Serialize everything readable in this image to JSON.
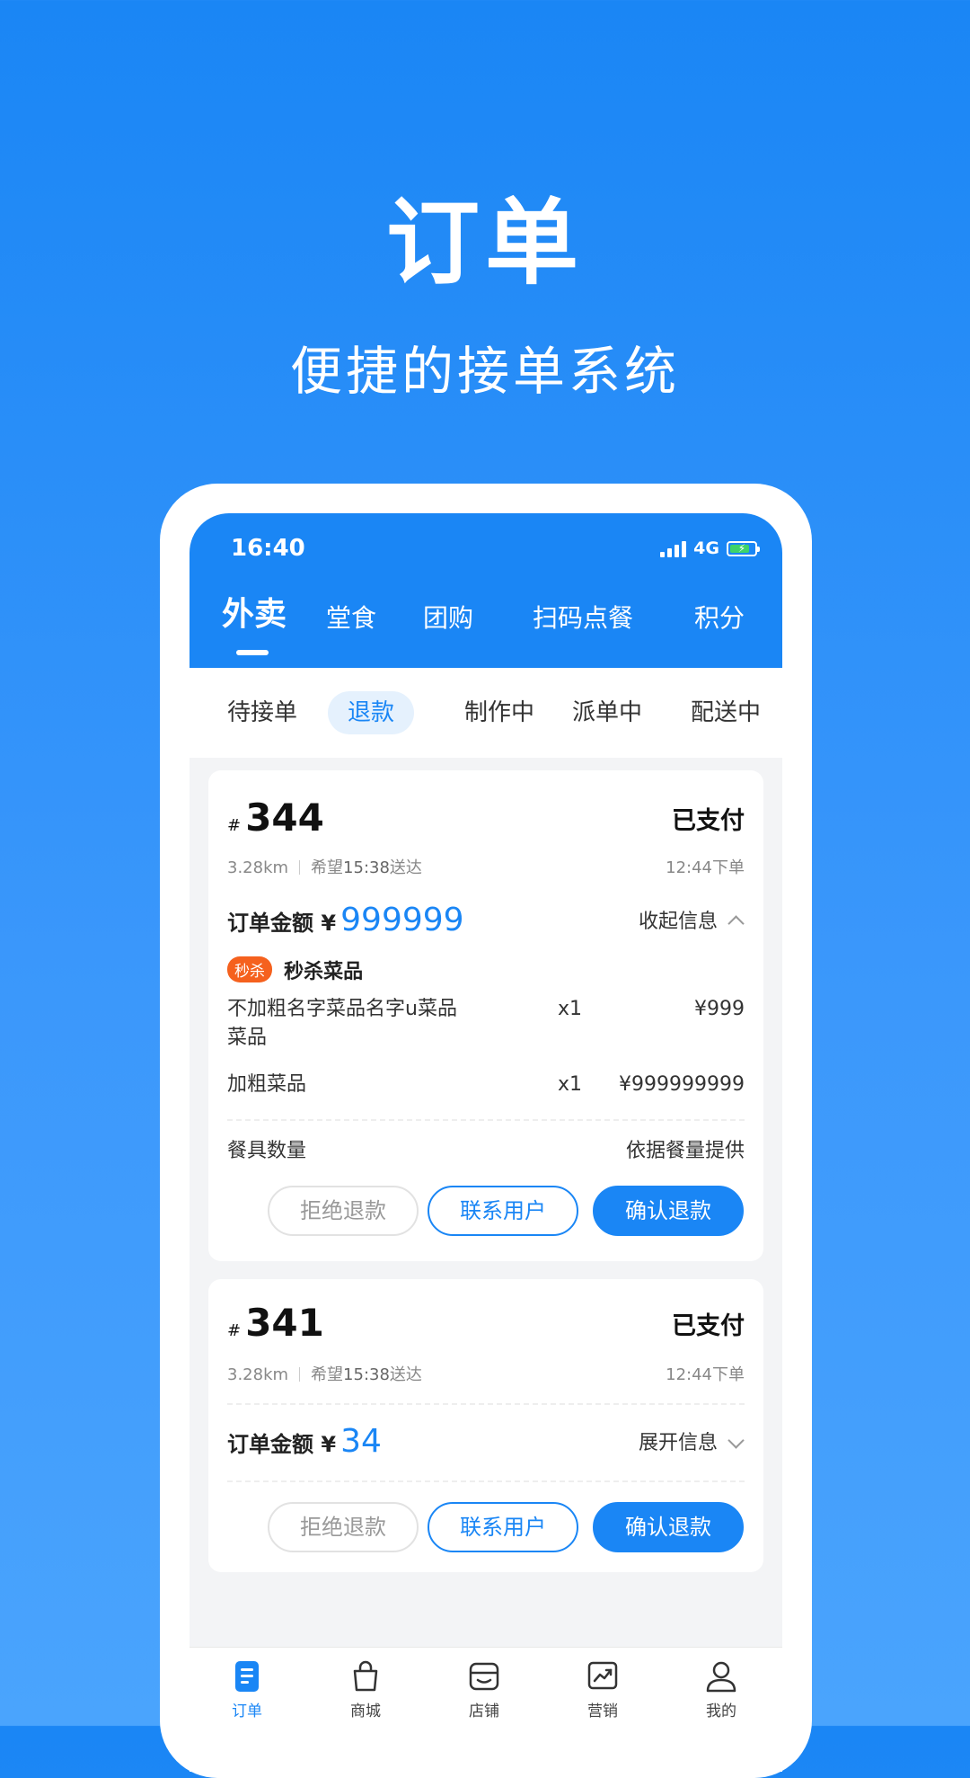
{
  "hero": {
    "title": "订单",
    "subtitle": "便捷的接单系统"
  },
  "status_bar": {
    "time": "16:40",
    "network": "4G"
  },
  "main_tabs": [
    {
      "label": "外卖",
      "active": true
    },
    {
      "label": "堂食"
    },
    {
      "label": "团购"
    },
    {
      "label": "扫码点餐"
    },
    {
      "label": "积分"
    }
  ],
  "sub_tabs": [
    {
      "label": "待接单"
    },
    {
      "label": "退款",
      "active": true
    },
    {
      "label": "制作中"
    },
    {
      "label": "派单中"
    },
    {
      "label": "配送中"
    }
  ],
  "orders": [
    {
      "hash": "#",
      "number": "344",
      "status": "已支付",
      "distance": "3.28km",
      "expect_prefix": "希望",
      "expect_time": "15:38",
      "expect_suffix": "送达",
      "order_time": "12:44下单",
      "amount_label": "订单金额 ¥",
      "amount": "999999",
      "toggle_label": "收起信息",
      "flash_tag": "秒杀",
      "flash_name": "秒杀菜品",
      "items": [
        {
          "name_line1": "不加粗名字菜品名字u菜品",
          "name_line2": "菜品",
          "qty": "x1",
          "price": "¥999"
        },
        {
          "name_line1": "加粗菜品",
          "qty": "x1",
          "price": "¥999999999"
        }
      ],
      "tableware_label": "餐具数量",
      "tableware_value": "依据餐量提供",
      "buttons": {
        "reject": "拒绝退款",
        "contact": "联系用户",
        "confirm": "确认退款"
      }
    },
    {
      "hash": "#",
      "number": "341",
      "status": "已支付",
      "distance": "3.28km",
      "expect_prefix": "希望",
      "expect_time": "15:38",
      "expect_suffix": "送达",
      "order_time": "12:44下单",
      "amount_label": "订单金额 ¥",
      "amount": "34",
      "toggle_label": "展开信息",
      "buttons": {
        "reject": "拒绝退款",
        "contact": "联系用户",
        "confirm": "确认退款"
      }
    }
  ],
  "bottom_nav": [
    {
      "label": "订单",
      "icon": "orders-icon",
      "active": true
    },
    {
      "label": "商城",
      "icon": "shopping-bag-icon"
    },
    {
      "label": "店铺",
      "icon": "store-icon"
    },
    {
      "label": "营销",
      "icon": "chart-icon"
    },
    {
      "label": "我的",
      "icon": "user-icon"
    }
  ],
  "colors": {
    "primary": "#1a86f5",
    "flash": "#f5611e",
    "battery": "#3ed36a"
  }
}
